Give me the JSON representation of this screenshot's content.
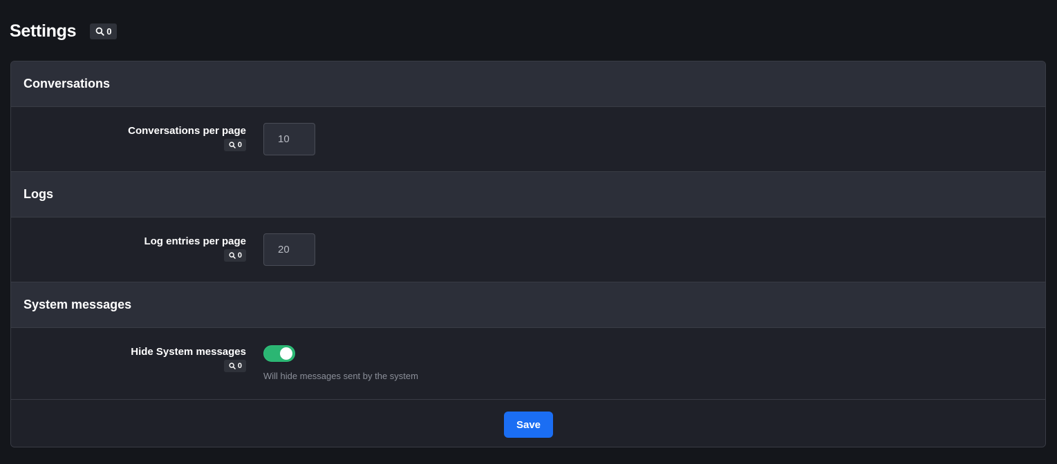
{
  "page": {
    "title": "Settings",
    "badge_count": "0",
    "badge_icon": "search-icon"
  },
  "sections": [
    {
      "title": "Conversations",
      "field": {
        "label": "Conversations per page",
        "badge_count": "0",
        "value": "10"
      }
    },
    {
      "title": "Logs",
      "field": {
        "label": "Log entries per page",
        "badge_count": "0",
        "value": "20"
      }
    },
    {
      "title": "System messages",
      "field": {
        "label": "Hide System messages",
        "badge_count": "0",
        "enabled": true,
        "help": "Will hide messages sent by the system"
      }
    }
  ],
  "footer": {
    "save_label": "Save"
  },
  "colors": {
    "background": "#14161b",
    "card": "#1f2129",
    "section_header": "#2c2f39",
    "toggle_on": "#2bb673",
    "primary_button": "#1b6ef3"
  }
}
